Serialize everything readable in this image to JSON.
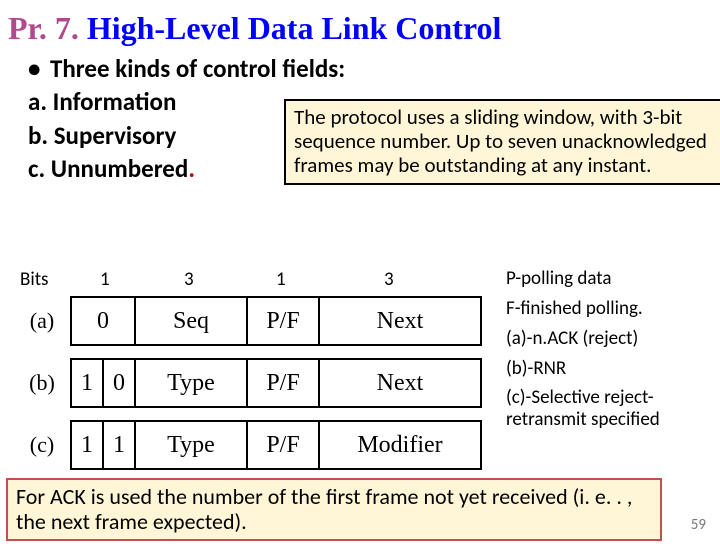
{
  "title": {
    "prefix": "Pr. 7.",
    "main": "High-Level Data Link Control"
  },
  "bullets": {
    "heading": "Three kinds of control fields:",
    "a": "a. Information",
    "b": "b. Supervisory",
    "c": "c. Unnumbered",
    "dot_after_c": "."
  },
  "protocol_box": "The protocol uses a sliding window, with 3-bit sequence number. Up to seven unacknowledged frames may be outstanding at any instant.",
  "bits_header": {
    "label": "Bits",
    "c1": "1",
    "c2": "3",
    "c3": "1",
    "c4": "3"
  },
  "rows": {
    "a": {
      "label": "(a)",
      "b1": "0",
      "b2": "",
      "seq": "Seq",
      "pf": "P/F",
      "last": "Next"
    },
    "b": {
      "label": "(b)",
      "b1": "1",
      "b2": "0",
      "seq": "Type",
      "pf": "P/F",
      "last": "Next"
    },
    "c": {
      "label": "(c)",
      "b1": "1",
      "b2": "1",
      "seq": "Type",
      "pf": "P/F",
      "last": "Modifier"
    }
  },
  "notes": {
    "n1": "P-polling data",
    "n2": "F-finished polling.",
    "n3": "(a)-n.ACK (reject)",
    "n4": "(b)-RNR",
    "n5": "(c)-Selective reject- retransmit specified"
  },
  "footer": "For ACK is used the number of the first frame not yet received (i. e. . , the next frame expected).",
  "page_number": "59"
}
